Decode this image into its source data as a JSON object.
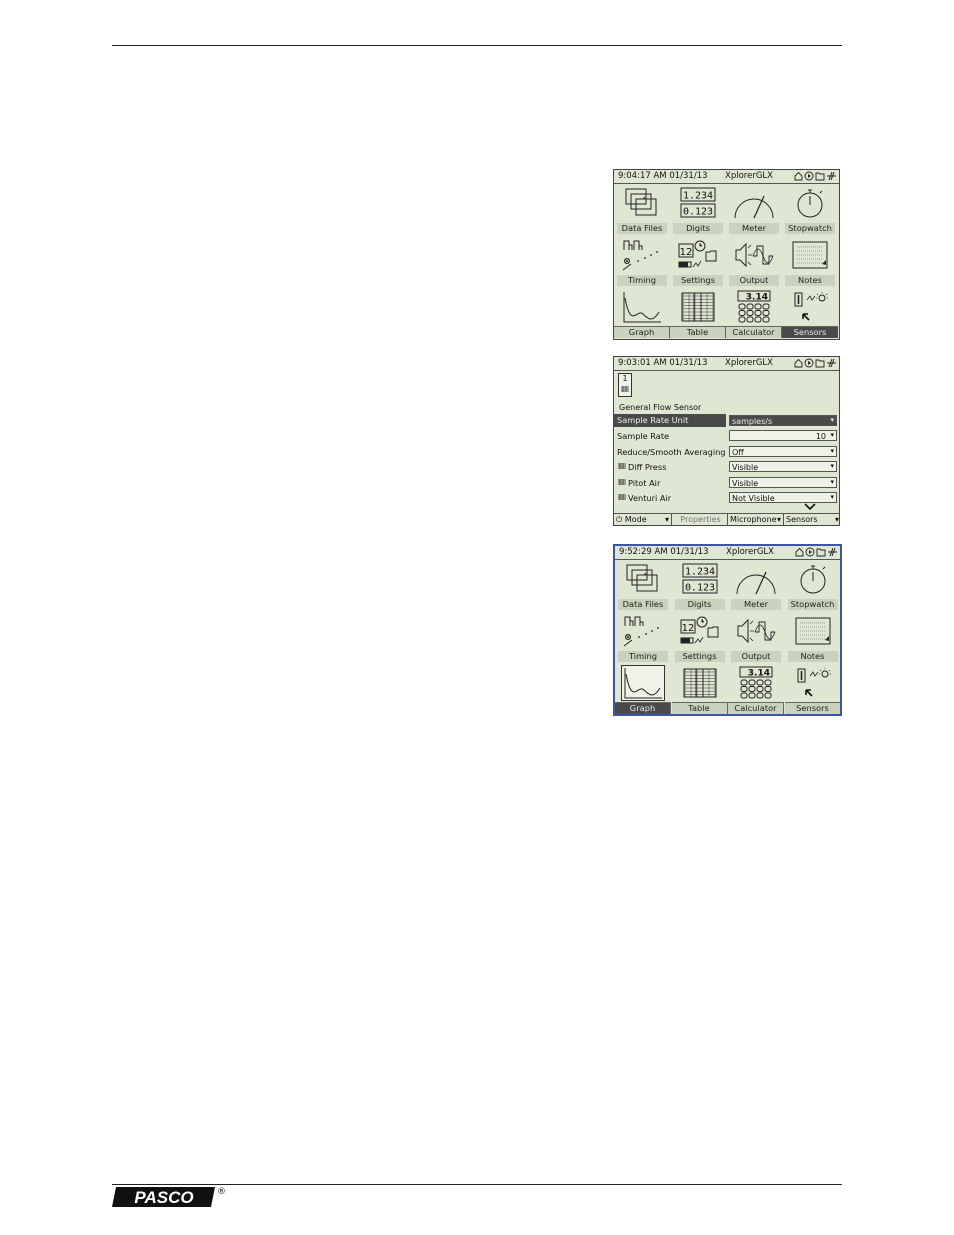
{
  "footer": {
    "brand": "PASCO",
    "reg_mark": "®"
  },
  "screens": {
    "home1": {
      "status": {
        "time": "9:04:17 AM  01/31/13",
        "title": "XplorerGLX"
      },
      "cells": [
        {
          "label": "Data Files",
          "icon": "data-files-icon"
        },
        {
          "label": "Digits",
          "icon": "digits-icon"
        },
        {
          "label": "Meter",
          "icon": "meter-icon"
        },
        {
          "label": "Stopwatch",
          "icon": "stopwatch-icon"
        },
        {
          "label": "Timing",
          "icon": "timing-icon"
        },
        {
          "label": "Settings",
          "icon": "settings-icon"
        },
        {
          "label": "Output",
          "icon": "output-icon"
        },
        {
          "label": "Notes",
          "icon": "notes-icon"
        },
        {
          "label": "Graph",
          "icon": "graph-icon"
        },
        {
          "label": "Table",
          "icon": "table-icon"
        },
        {
          "label": "Calculator",
          "icon": "calculator-icon"
        },
        {
          "label": "Sensors",
          "icon": "sensors-icon"
        }
      ],
      "digits_top": "1.234",
      "digits_bottom": "0.123",
      "settings_digit": "12",
      "calc_display": "3.14",
      "selected": "Sensors"
    },
    "sensor": {
      "status": {
        "time": "9:03:01 AM  01/31/13",
        "title": "XplorerGLX"
      },
      "port": "1",
      "name": "General Flow Sensor",
      "rows": [
        {
          "key": "Sample Rate Unit",
          "value": "samples/s"
        },
        {
          "key": "Sample Rate",
          "value": "10"
        },
        {
          "key": "Reduce/Smooth Averaging",
          "value": "Off"
        },
        {
          "key": "Diff Press",
          "value": "Visible"
        },
        {
          "key": "Pitot Air",
          "value": "Visible"
        },
        {
          "key": "Venturi Air",
          "value": "Not Visible"
        }
      ],
      "softkeys": [
        "Mode",
        "Properties",
        "Microphone",
        "Sensors"
      ]
    },
    "home2": {
      "status": {
        "time": "9:52:29 AM  01/31/13",
        "title": "XplorerGLX"
      },
      "cells": [
        {
          "label": "Data Files"
        },
        {
          "label": "Digits"
        },
        {
          "label": "Meter"
        },
        {
          "label": "Stopwatch"
        },
        {
          "label": "Timing"
        },
        {
          "label": "Settings"
        },
        {
          "label": "Output"
        },
        {
          "label": "Notes"
        },
        {
          "label": "Graph"
        },
        {
          "label": "Table"
        },
        {
          "label": "Calculator"
        },
        {
          "label": "Sensors"
        }
      ],
      "digits_top": "1.234",
      "digits_bottom": "0.123",
      "settings_digit": "12",
      "calc_display": "3.14",
      "selected": "Graph"
    }
  }
}
